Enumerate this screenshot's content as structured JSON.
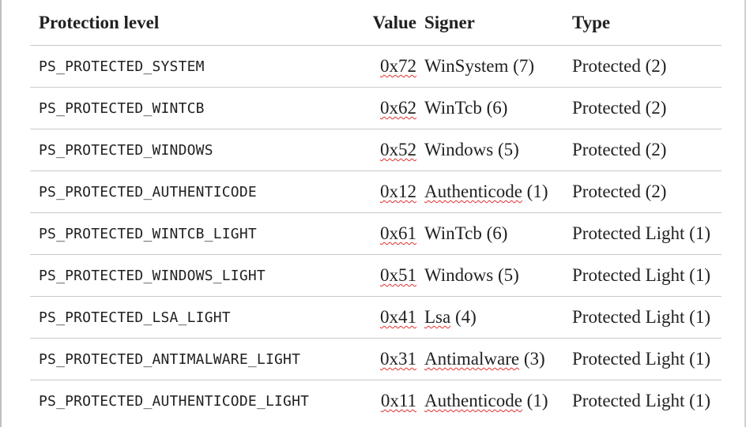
{
  "headers": {
    "level": "Protection level",
    "value": "Value",
    "signer": "Signer",
    "type": "Type"
  },
  "rows": [
    {
      "level": "PS_PROTECTED_SYSTEM",
      "value": "0x72",
      "signer_name": "WinSystem",
      "signer_code": "(7)",
      "signer_spell": false,
      "type": "Protected (2)"
    },
    {
      "level": "PS_PROTECTED_WINTCB",
      "value": "0x62",
      "signer_name": "WinTcb",
      "signer_code": "(6)",
      "signer_spell": false,
      "type": "Protected (2)"
    },
    {
      "level": "PS_PROTECTED_WINDOWS",
      "value": "0x52",
      "signer_name": "Windows",
      "signer_code": "(5)",
      "signer_spell": false,
      "type": "Protected (2)"
    },
    {
      "level": "PS_PROTECTED_AUTHENTICODE",
      "value": "0x12",
      "signer_name": "Authenticode",
      "signer_code": "(1)",
      "signer_spell": true,
      "type": "Protected (2)"
    },
    {
      "level": "PS_PROTECTED_WINTCB_LIGHT",
      "value": "0x61",
      "signer_name": "WinTcb",
      "signer_code": "(6)",
      "signer_spell": false,
      "type": "Protected Light (1)"
    },
    {
      "level": "PS_PROTECTED_WINDOWS_LIGHT",
      "value": "0x51",
      "signer_name": "Windows",
      "signer_code": "(5)",
      "signer_spell": false,
      "type": "Protected Light (1)"
    },
    {
      "level": "PS_PROTECTED_LSA_LIGHT",
      "value": "0x41",
      "signer_name": "Lsa",
      "signer_code": "(4)",
      "signer_spell": true,
      "type": "Protected Light (1)"
    },
    {
      "level": "PS_PROTECTED_ANTIMALWARE_LIGHT",
      "value": "0x31",
      "signer_name": "Antimalware",
      "signer_code": "(3)",
      "signer_spell": true,
      "type": "Protected Light (1)"
    },
    {
      "level": "PS_PROTECTED_AUTHENTICODE_LIGHT",
      "value": "0x11",
      "signer_name": "Authenticode",
      "signer_code": "(1)",
      "signer_spell": true,
      "type": "Protected Light (1)"
    }
  ]
}
